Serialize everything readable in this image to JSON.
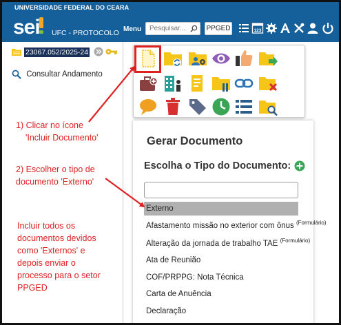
{
  "header": {
    "university": "UNIVERSIDADE FEDERAL DO CEARA",
    "logo_text": "sei",
    "unit": "UFC - PROTOCOLO",
    "menu_label": "Menu",
    "search_placeholder": "Pesquisar...",
    "unit_button": "PPGED",
    "icons": [
      "list-icon",
      "calendar-123-icon",
      "gear-icon",
      "font-size-icon",
      "tools-icon",
      "user-icon",
      "power-icon"
    ],
    "color": "#155f9a"
  },
  "sidebar": {
    "process_number": "23067.052/2025-24",
    "consult_label": "Consultar Andamento"
  },
  "toolbar": {
    "icons": [
      "incluir-documento-icon",
      "folder-refresh-icon",
      "folder-users-icon",
      "eye-icon",
      "thumb-icon",
      "folder-send-icon",
      "briefcase-add-icon",
      "building-person-icon",
      "note-pin-icon",
      "folder-pause-icon",
      "link-icon",
      "folder-close-icon",
      "comment-icon",
      "trash-icon",
      "tag-icon",
      "clock-icon",
      "list-icon",
      "folder-search-icon"
    ]
  },
  "panel": {
    "title": "Gerar Documento",
    "subtitle": "Escolha o Tipo do Documento:",
    "filter_value": "",
    "items": [
      {
        "label": "Externo",
        "tag": ""
      },
      {
        "label": "Afastamento missão no exterior com ônus",
        "tag": "(Formulário)"
      },
      {
        "label": "Alteração da jornada de trabalho TAE",
        "tag": "(Formulário)"
      },
      {
        "label": "Ata de Reunião",
        "tag": ""
      },
      {
        "label": "COF/PRPPG: Nota Técnica",
        "tag": ""
      },
      {
        "label": "Carta de Anuência",
        "tag": ""
      },
      {
        "label": "Declaração",
        "tag": ""
      }
    ]
  },
  "annotations": {
    "step1_a": "1) Clicar no ícone",
    "step1_b": "'Incluir Documento'",
    "step2_a": "2) Escolher o tipo de",
    "step2_b": "documento 'Externo'",
    "note_a": "Incluir todos os",
    "note_b": "documentos devidos",
    "note_c": "como 'Externos' e",
    "note_d": "depois enviar o",
    "note_e": "processo para o setor",
    "note_f": "PPGED",
    "color": "#e02020"
  }
}
